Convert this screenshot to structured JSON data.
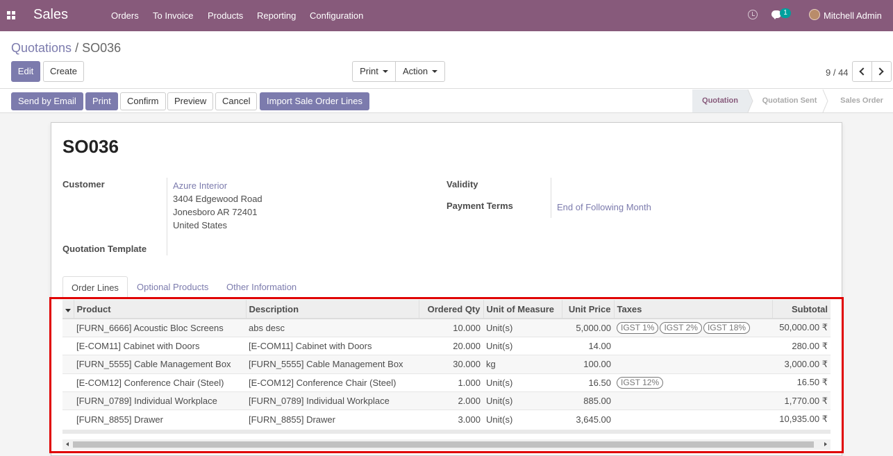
{
  "app": {
    "brand": "Sales",
    "menu": [
      "Orders",
      "To Invoice",
      "Products",
      "Reporting",
      "Configuration"
    ],
    "chat_badge": "1",
    "user_name": "Mitchell Admin"
  },
  "breadcrumb": {
    "parent": "Quotations",
    "separator": "/",
    "current": "SO036"
  },
  "toolbar": {
    "edit_label": "Edit",
    "create_label": "Create",
    "print_label": "Print",
    "action_label": "Action",
    "pager": "9 / 44"
  },
  "statusbar": {
    "buttons": [
      "Send by Email",
      "Print",
      "Confirm",
      "Preview",
      "Cancel",
      "Import Sale Order Lines"
    ],
    "stages": [
      "Quotation",
      "Quotation Sent",
      "Sales Order"
    ],
    "active_stage": "Quotation"
  },
  "form": {
    "title": "SO036",
    "customer_label": "Customer",
    "customer_name": "Azure Interior",
    "customer_address": [
      "3404 Edgewood Road",
      "Jonesboro AR 72401",
      "United States"
    ],
    "quotation_template_label": "Quotation Template",
    "validity_label": "Validity",
    "payment_terms_label": "Payment Terms",
    "payment_terms_value": "End of Following Month"
  },
  "tabs": [
    "Order Lines",
    "Optional Products",
    "Other Information"
  ],
  "order_lines": {
    "headers": [
      "Product",
      "Description",
      "Ordered Qty",
      "Unit of Measure",
      "Unit Price",
      "Taxes",
      "Subtotal"
    ],
    "rows": [
      {
        "product": "[FURN_6666] Acoustic Bloc Screens",
        "description": "abs desc",
        "qty": "10.000",
        "uom": "Unit(s)",
        "price": "5,000.00",
        "taxes": [
          "IGST 1%",
          "IGST 2%",
          "IGST 18%"
        ],
        "subtotal": "50,000.00 ₹"
      },
      {
        "product": "[E-COM11] Cabinet with Doors",
        "description": "[E-COM11] Cabinet with Doors",
        "qty": "20.000",
        "uom": "Unit(s)",
        "price": "14.00",
        "taxes": [],
        "subtotal": "280.00 ₹"
      },
      {
        "product": "[FURN_5555] Cable Management Box",
        "description": "[FURN_5555] Cable Management Box",
        "qty": "30.000",
        "uom": "kg",
        "price": "100.00",
        "taxes": [],
        "subtotal": "3,000.00 ₹"
      },
      {
        "product": "[E-COM12] Conference Chair (Steel)",
        "description": "[E-COM12] Conference Chair (Steel)",
        "qty": "1.000",
        "uom": "Unit(s)",
        "price": "16.50",
        "taxes": [
          "IGST 12%"
        ],
        "subtotal": "16.50 ₹"
      },
      {
        "product": "[FURN_0789] Individual Workplace",
        "description": "[FURN_0789] Individual Workplace",
        "qty": "2.000",
        "uom": "Unit(s)",
        "price": "885.00",
        "taxes": [],
        "subtotal": "1,770.00 ₹"
      },
      {
        "product": "[FURN_8855] Drawer",
        "description": "[FURN_8855] Drawer",
        "qty": "3.000",
        "uom": "Unit(s)",
        "price": "3,645.00",
        "taxes": [],
        "subtotal": "10,935.00 ₹"
      }
    ]
  },
  "colors": {
    "navbar": "#875a7b",
    "primary": "#7c7bad",
    "highlight": "#e00000"
  }
}
